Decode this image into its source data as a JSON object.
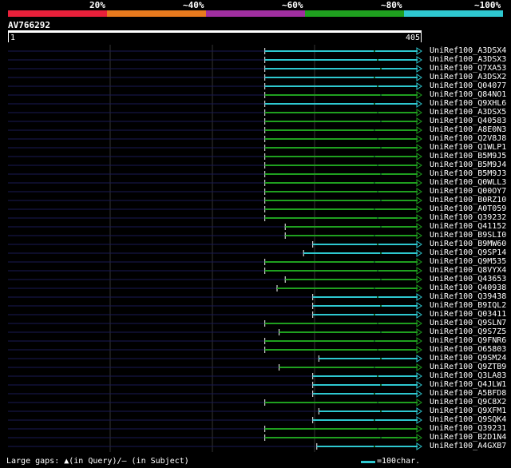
{
  "legend": {
    "labels": [
      "20%",
      "~40%",
      "~60%",
      "~80%",
      "~100%"
    ],
    "colors": [
      "#e8203a",
      "#e87a1e",
      "#a02fa0",
      "#1fa01f",
      "#2ec8d0"
    ]
  },
  "query": {
    "title": "AV766292",
    "start": "1",
    "end": "405"
  },
  "hits": [
    {
      "id": "UniRef100_A3DSX4",
      "start": 252,
      "color": "#2ec8d0"
    },
    {
      "id": "UniRef100_A3DSX3",
      "start": 252,
      "color": "#2ec8d0"
    },
    {
      "id": "UniRef100_Q7XA53",
      "start": 252,
      "color": "#2ec8d0"
    },
    {
      "id": "UniRef100_A3DSX2",
      "start": 252,
      "color": "#2ec8d0"
    },
    {
      "id": "UniRef100_Q04077",
      "start": 252,
      "color": "#2ec8d0"
    },
    {
      "id": "UniRef100_Q84NO1",
      "start": 252,
      "color": "#1fa01f"
    },
    {
      "id": "UniRef100_Q9XHL6",
      "start": 252,
      "color": "#2ec8d0"
    },
    {
      "id": "UniRef100_A3DSX5",
      "start": 252,
      "color": "#1fa01f"
    },
    {
      "id": "UniRef100_Q40583",
      "start": 252,
      "color": "#1fa01f"
    },
    {
      "id": "UniRef100_A8E0N3",
      "start": 252,
      "color": "#1fa01f"
    },
    {
      "id": "UniRef100_Q2V8J8",
      "start": 252,
      "color": "#1fa01f"
    },
    {
      "id": "UniRef100_Q1WLP1",
      "start": 252,
      "color": "#1fa01f"
    },
    {
      "id": "UniRef100_B5M9J5",
      "start": 252,
      "color": "#1fa01f"
    },
    {
      "id": "UniRef100_B5M9J4",
      "start": 252,
      "color": "#1fa01f"
    },
    {
      "id": "UniRef100_B5M9J3",
      "start": 252,
      "color": "#1fa01f"
    },
    {
      "id": "UniRef100_Q0WLL3",
      "start": 252,
      "color": "#1fa01f"
    },
    {
      "id": "UniRef100_Q00OY7",
      "start": 252,
      "color": "#1fa01f"
    },
    {
      "id": "UniRef100_B0RZ10",
      "start": 252,
      "color": "#1fa01f"
    },
    {
      "id": "UniRef100_A0T059",
      "start": 252,
      "color": "#1fa01f"
    },
    {
      "id": "UniRef100_Q39232",
      "start": 252,
      "color": "#1fa01f"
    },
    {
      "id": "UniRef100_Q41152",
      "start": 272,
      "color": "#1fa01f"
    },
    {
      "id": "UniRef100_B9SLI0",
      "start": 272,
      "color": "#1fa01f"
    },
    {
      "id": "UniRef100_B9MW60",
      "start": 299,
      "color": "#2ec8d0"
    },
    {
      "id": "UniRef100_Q9SP14",
      "start": 290,
      "color": "#2ec8d0"
    },
    {
      "id": "UniRef100_Q9M535",
      "start": 252,
      "color": "#1fa01f"
    },
    {
      "id": "UniRef100_Q8VYX4",
      "start": 252,
      "color": "#1fa01f"
    },
    {
      "id": "UniRef100_Q43653",
      "start": 272,
      "color": "#1fa01f"
    },
    {
      "id": "UniRef100_Q40938",
      "start": 264,
      "color": "#1fa01f"
    },
    {
      "id": "UniRef100_Q39438",
      "start": 299,
      "color": "#2ec8d0"
    },
    {
      "id": "UniRef100_B9IQL2",
      "start": 299,
      "color": "#2ec8d0"
    },
    {
      "id": "UniRef100_Q03411",
      "start": 299,
      "color": "#2ec8d0"
    },
    {
      "id": "UniRef100_Q9SLN7",
      "start": 252,
      "color": "#1fa01f"
    },
    {
      "id": "UniRef100_Q9S7Z5",
      "start": 266,
      "color": "#1fa01f"
    },
    {
      "id": "UniRef100_Q9FNR6",
      "start": 252,
      "color": "#1fa01f"
    },
    {
      "id": "UniRef100_O65803",
      "start": 252,
      "color": "#1fa01f"
    },
    {
      "id": "UniRef100_Q9SM24",
      "start": 305,
      "color": "#2ec8d0"
    },
    {
      "id": "UniRef100_Q9ZTB9",
      "start": 266,
      "color": "#1fa01f"
    },
    {
      "id": "UniRef100_Q3LA83",
      "start": 299,
      "color": "#2ec8d0"
    },
    {
      "id": "UniRef100_Q4JLW1",
      "start": 299,
      "color": "#2ec8d0"
    },
    {
      "id": "UniRef100_A5BFD8",
      "start": 299,
      "color": "#2ec8d0"
    },
    {
      "id": "UniRef100_Q9C8X2",
      "start": 252,
      "color": "#1fa01f"
    },
    {
      "id": "UniRef100_Q9XFM1",
      "start": 305,
      "color": "#2ec8d0"
    },
    {
      "id": "UniRef100_Q9SQK4",
      "start": 299,
      "color": "#2ec8d0"
    },
    {
      "id": "UniRef100_Q39231",
      "start": 252,
      "color": "#1fa01f"
    },
    {
      "id": "UniRef100_B2D1N4",
      "start": 252,
      "color": "#1fa01f"
    },
    {
      "id": "UniRef100_A4GXB7",
      "start": 303,
      "color": "#2ec8d0"
    }
  ],
  "footer": {
    "gaps_text": "Large gaps: ▲(in Query)/— (in Subject)",
    "scale_text": "=100char."
  }
}
